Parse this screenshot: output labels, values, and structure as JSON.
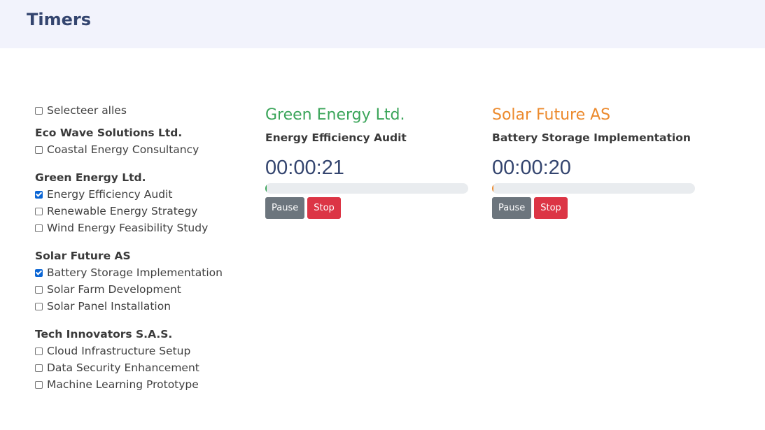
{
  "header": {
    "title": "Timers"
  },
  "sidebar": {
    "select_all_label": "Selecteer alles",
    "groups": [
      {
        "client": "Eco Wave Solutions Ltd.",
        "projects": [
          {
            "label": "Coastal Energy Consultancy",
            "checked": false
          }
        ]
      },
      {
        "client": "Green Energy Ltd.",
        "projects": [
          {
            "label": "Energy Efficiency Audit",
            "checked": true
          },
          {
            "label": "Renewable Energy Strategy",
            "checked": false
          },
          {
            "label": "Wind Energy Feasibility Study",
            "checked": false
          }
        ]
      },
      {
        "client": "Solar Future AS",
        "projects": [
          {
            "label": "Battery Storage Implementation",
            "checked": true
          },
          {
            "label": "Solar Farm Development",
            "checked": false
          },
          {
            "label": "Solar Panel Installation",
            "checked": false
          }
        ]
      },
      {
        "client": "Tech Innovators S.A.S.",
        "projects": [
          {
            "label": "Cloud Infrastructure Setup",
            "checked": false
          },
          {
            "label": "Data Security Enhancement",
            "checked": false
          },
          {
            "label": "Machine Learning Prototype",
            "checked": false
          }
        ]
      }
    ]
  },
  "timers": [
    {
      "client": "Green Energy Ltd.",
      "task": "Energy Efficiency Audit",
      "time": "00:00:21",
      "color": "#3ba55a",
      "progress": 0.005,
      "pause_label": "Pause",
      "stop_label": "Stop"
    },
    {
      "client": "Solar Future AS",
      "task": "Battery Storage Implementation",
      "time": "00:00:20",
      "color": "#ec8a2d",
      "progress": 0.008,
      "pause_label": "Pause",
      "stop_label": "Stop"
    }
  ]
}
